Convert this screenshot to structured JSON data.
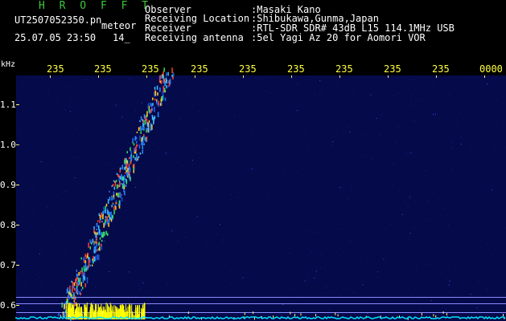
{
  "header": {
    "app_title": "H R O F F T",
    "filename": "UT2507052350.pn",
    "mode": "meteor",
    "datetime": "25.07.05 23:50",
    "index": "14_",
    "fields": [
      {
        "label": "Observer",
        "value": ":Masaki Kano"
      },
      {
        "label": "Receiving Location",
        "value": ":Shibukawa,Gunma,Japan"
      },
      {
        "label": "Receiver",
        "value": ":RTL-SDR SDR# 43dB L15 114.1MHz USB"
      },
      {
        "label": "Receiving antenna",
        "value": ":5el Yagi Az 20 for Aomori VOR"
      }
    ]
  },
  "axis": {
    "unit": "kHz",
    "time_ticks": [
      "235",
      "235",
      "235",
      "235",
      "235",
      "235",
      "235",
      "235",
      "235",
      "0000"
    ],
    "freq_ticks": [
      "1.1",
      "1.0",
      "0.9",
      "0.8",
      "0.7",
      "0.6"
    ]
  },
  "colors": {
    "background": "#000000",
    "plot": "#050a4a",
    "title_green": "#39c739",
    "tick_yellow": "#ffff40",
    "meteor_trail": "#2a8cff",
    "noise_yellow": "#ffff00",
    "baseline_cyan": "#00e6ff"
  }
}
